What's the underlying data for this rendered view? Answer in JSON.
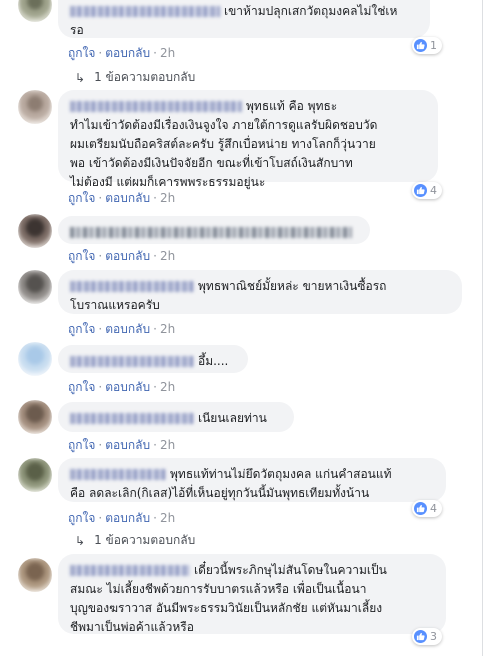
{
  "labels": {
    "like": "ถูกใจ",
    "reply": "ตอบกลับ",
    "separator": "·"
  },
  "colors": {
    "link": "#4267b2",
    "bubble": "#f2f3f5",
    "like_icon": "#5890ff"
  },
  "comments": [
    {
      "text": "เขาห้ามปลุกเสกวัตถุมงคลไม่ใช่เหรอ",
      "text_lines": [
        "เขาห้ามปลุกเสกวัตถุมงคลไม่ใช่เห",
        "รอ"
      ],
      "time": "2h",
      "reactions": "1"
    },
    {
      "text_lines": [
        "พุทธแท้ คือ พุทธะ",
        "ทำไมเข้าวัดต้องมีเรื่องเงินจูงใจ ภายใต้การดูแลรับผิดชอบวัด",
        "ผมเตรียมนับถือคริสต์ละครับ รู้สึกเบื่อหน่าย ทางโลกก็วุ่นวาย",
        "พอ เข้าวัดต้องมีเงินปัจจัยอีก ขณะที่เข้าโบสถ์เงินสักบาท",
        "ไม่ต้องมี แต่ผมก็เคารพพระธรรมอยู่นะ"
      ],
      "time": "2h",
      "reactions": "4"
    },
    {
      "text_lines": [
        ""
      ],
      "time": "2h"
    },
    {
      "text_lines": [
        "พุทธพาณิชย์มั้ยหล่ะ ขายหาเงินซื้อรถ",
        "โบราณแหรอครับ"
      ],
      "time": "2h"
    },
    {
      "text_lines": [
        "อึ้ม...."
      ],
      "time": "2h"
    },
    {
      "text_lines": [
        "เนียนเลยท่าน"
      ],
      "time": "2h"
    },
    {
      "text_lines": [
        "พุทธแท้ท่านไม่ยึดวัตถุมงคล แก่นคำสอนแท้",
        "คือ ลดละเลิก(กิเลส)ไอ้ที่เห็นอยู่ทุกวันนี้มันพุทธเทียมทั้งน้าน"
      ],
      "time": "2h",
      "reactions": "4"
    },
    {
      "text_lines": [
        "เดี๋ยวนี้พระภิกษุไม่สันโดษในความเป็น",
        "สมณะ ไม่เลี้ยงชีพด้วยการรับบาตรแล้วหรือ เพื่อเป็นเนื้อนา",
        "บุญของฆราวาส อันมีพระธรรมวินัยเป็นหลักชัย แต่หันมาเลี้ยง",
        "ชีพมาเป็นพ่อค้าแล้วหรือ"
      ],
      "time": "2h",
      "reactions": "3"
    }
  ],
  "reply_links": [
    "1 ข้อความตอบกลับ",
    "1 ข้อความตอบกลับ"
  ]
}
